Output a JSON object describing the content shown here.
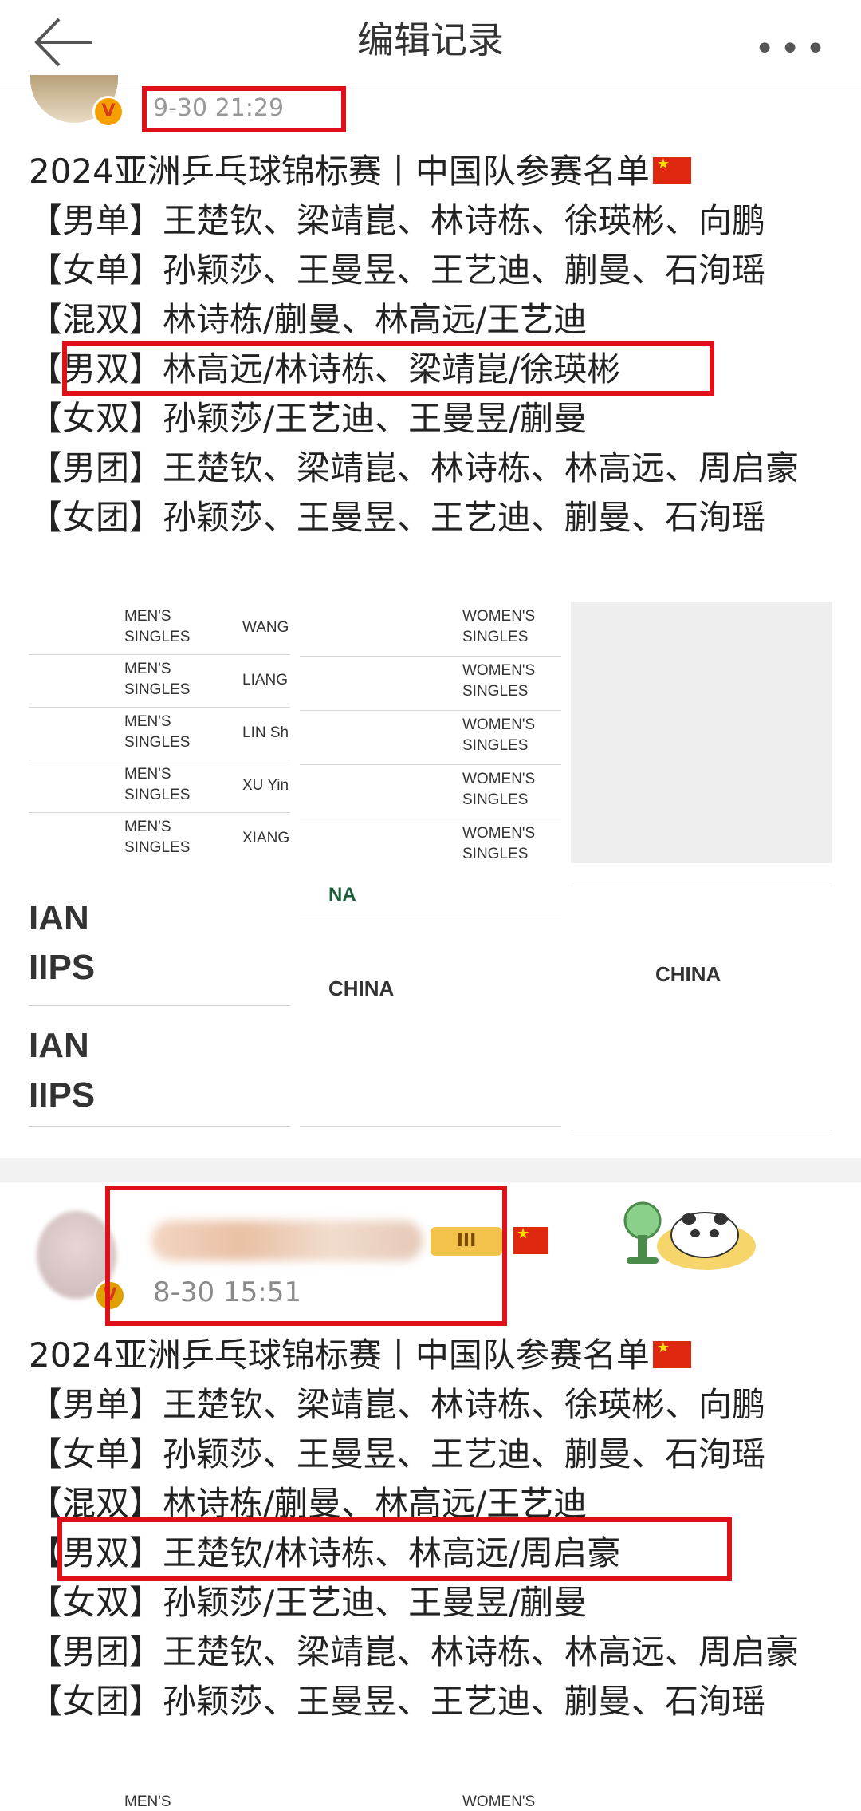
{
  "header": {
    "title": "编辑记录",
    "more": "•••"
  },
  "post1": {
    "time": "9-30 21:29",
    "lines": [
      "2024亚洲乒乓球锦标赛丨中国队参赛名单",
      "【男单】王楚钦、梁靖崑、林诗栋、徐瑛彬、向鹏",
      "【女单】孙颖莎、王曼昱、王艺迪、蒯曼、石洵瑶",
      "【混双】林诗栋/蒯曼、林高远/王艺迪",
      "【男双】林高远/林诗栋、梁靖崑/徐瑛彬",
      "【女双】孙颖莎/王艺迪、王曼昱/蒯曼",
      "【男团】王楚钦、梁靖崑、林诗栋、林高远、周启豪",
      "【女团】孙颖莎、王曼昱、王艺迪、蒯曼、石洵瑶"
    ],
    "images": {
      "mens_events": [
        "MEN'S SINGLES",
        "MEN'S SINGLES",
        "MEN'S SINGLES",
        "MEN'S SINGLES",
        "MEN'S SINGLES"
      ],
      "mens_names": [
        "WANG",
        "LIANG",
        "LIN Sh",
        "XU Yin",
        "XIANG"
      ],
      "womens_events": [
        "WOMEN'S SINGLES",
        "WOMEN'S SINGLES",
        "WOMEN'S SINGLES",
        "WOMEN'S SINGLES",
        "WOMEN'S SINGLES"
      ],
      "big_a": "IAN IIPS",
      "big_b": "IAN IIPS",
      "na": "NA",
      "china_a": "CHINA",
      "china_b": "CHINA"
    }
  },
  "post2": {
    "level": "III",
    "time": "8-30 15:51",
    "lines": [
      "2024亚洲乒乓球锦标赛丨中国队参赛名单",
      "【男单】王楚钦、梁靖崑、林诗栋、徐瑛彬、向鹏",
      "【女单】孙颖莎、王曼昱、王艺迪、蒯曼、石洵瑶",
      "【混双】林诗栋/蒯曼、林高远/王艺迪",
      "【男双】王楚钦/林诗栋、林高远/周启豪",
      "【女双】孙颖莎/王艺迪、王曼昱/蒯曼",
      "【男团】王楚钦、梁靖崑、林诗栋、林高远、周启豪",
      "【女团】孙颖莎、王曼昱、王艺迪、蒯曼、石洵瑶"
    ],
    "images": {
      "mens_event": "MEN'S",
      "womens_event": "WOMEN'S"
    }
  },
  "colors": {
    "highlight": "#e0101a",
    "flag": "#de2910"
  }
}
